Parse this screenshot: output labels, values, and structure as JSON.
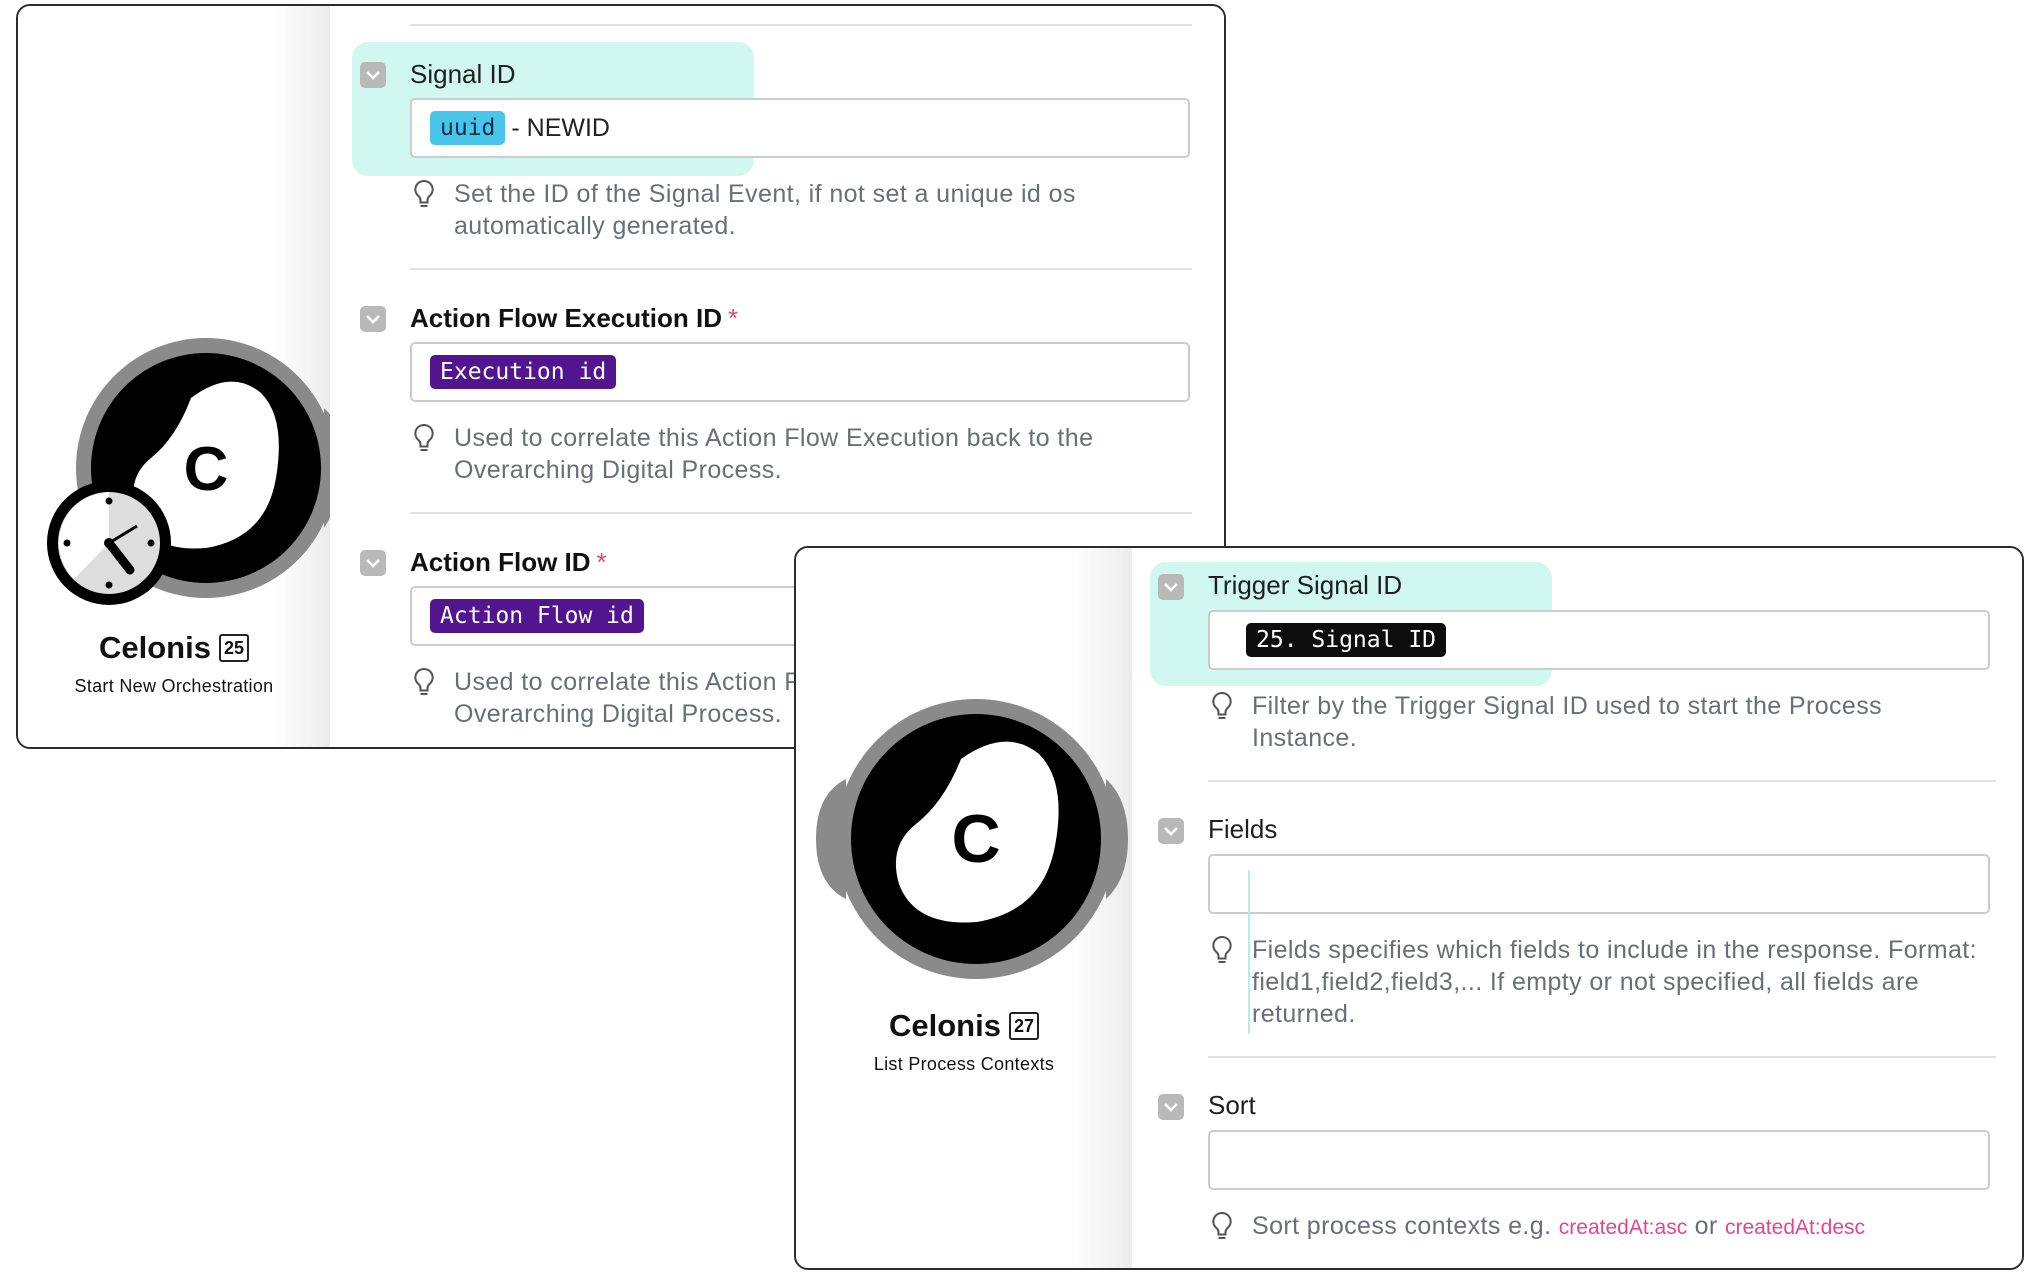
{
  "start_module": {
    "app_name": "Celonis",
    "module_number": "25",
    "action": "Start New Orchestration",
    "fields": [
      {
        "label": "Signal ID",
        "required": false,
        "pill": "uuid",
        "pill_color": "#48c6ea",
        "suffix": "- NEWID",
        "hint": "Set the ID of the Signal Event, if not set a unique id os automatically generated."
      },
      {
        "label": "Action Flow Execution ID",
        "required": true,
        "pill": "Execution id",
        "pill_color": "#52158f",
        "hint": "Used to correlate this Action Flow Execution back to the Overarching Digital Process."
      },
      {
        "label": "Action Flow ID",
        "required": true,
        "pill": "Action Flow id",
        "pill_color": "#52158f",
        "hint": "Used to correlate this Action Flow Execution back to the Overarching Digital Process."
      }
    ]
  },
  "list_module": {
    "app_name": "Celonis",
    "module_number": "27",
    "action": "List Process Contexts",
    "fields": [
      {
        "label": "Trigger Signal ID",
        "pill": "25. Signal ID",
        "pill_color": "#0d0d0d",
        "hint": "Filter by the Trigger Signal ID used to start the Process Instance."
      },
      {
        "label": "Fields",
        "value": "",
        "hint": "Fields specifies which fields to include in the response. Format: field1,field2,field3,... If empty or not specified, all fields are returned."
      },
      {
        "label": "Sort",
        "value": "",
        "hint_prefix": "Sort process contexts e.g.",
        "hint_code_1": "createdAt:asc",
        "hint_mid": "or",
        "hint_code_2": "createdAt:desc"
      }
    ]
  },
  "colors": {
    "highlight": "#96f0de",
    "required_star": "#e14b5a",
    "code_text": "#e5468a",
    "checkbox": "#b9b9b9"
  },
  "icons": {
    "app": "celonis-logo-icon",
    "trigger": "clock-icon",
    "checkbox": "chevron-down-icon",
    "hint": "lightbulb-icon"
  }
}
